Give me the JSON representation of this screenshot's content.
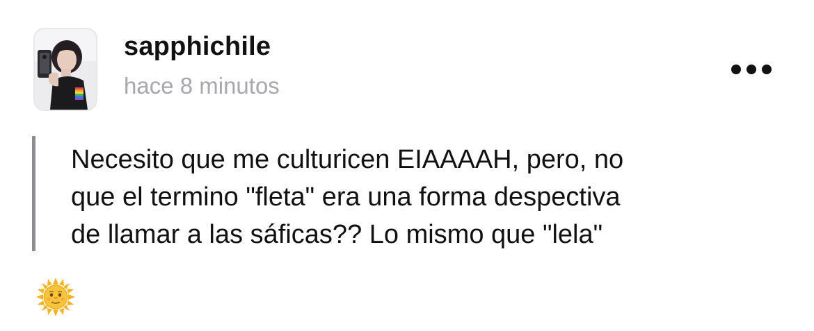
{
  "post": {
    "author": "sapphichile",
    "timestamp": "hace 8 minutos",
    "body_lines": [
      "Necesito que me culturicen EIAAAAH, pero, no",
      "que el termino \"fleta\" era una forma despectiva",
      "de llamar a las sáficas?? Lo mismo que \"lela\""
    ],
    "reaction_icon": "sun-with-face-icon",
    "more_icon": "more-options-icon"
  },
  "colors": {
    "text": "#111111",
    "muted": "#a7a7ad",
    "quote_bar": "#8b8b90",
    "avatar_border": "#e7e7ea"
  }
}
